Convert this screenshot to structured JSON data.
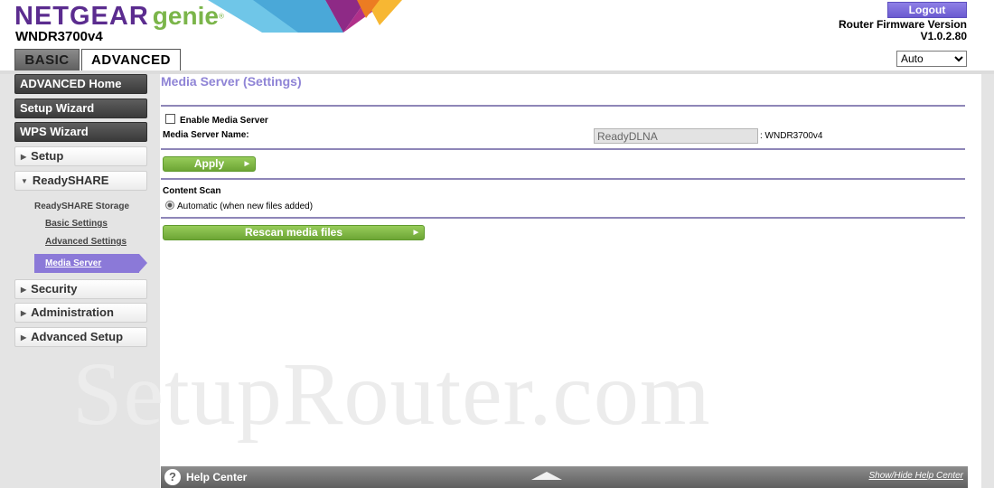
{
  "brand": {
    "name": "NETGEAR",
    "product": "genie",
    "tm": "®",
    "model": "WNDR3700v4"
  },
  "header": {
    "logout_label": "Logout",
    "firmware_label": "Router Firmware Version",
    "firmware_version": "V1.0.2.80",
    "language_selected": "Auto"
  },
  "tabs": [
    {
      "label": "BASIC",
      "active": false
    },
    {
      "label": "ADVANCED",
      "active": true
    }
  ],
  "sidebar": {
    "dark_items": [
      "ADVANCED Home",
      "Setup Wizard",
      "WPS Wizard"
    ],
    "setup": "Setup",
    "readyshare": "ReadySHARE",
    "readyshare_storage": "ReadySHARE Storage",
    "basic_settings": "Basic Settings",
    "advanced_settings": "Advanced Settings",
    "media_server": "Media Server",
    "security": "Security",
    "administration": "Administration",
    "advanced_setup": "Advanced Setup"
  },
  "main": {
    "title": "Media Server (Settings)",
    "enable_label": "Enable Media Server",
    "enable_checked": false,
    "name_label": "Media Server Name:",
    "name_value": "ReadyDLNA",
    "name_suffix": ": WNDR3700v4",
    "apply_label": "Apply",
    "content_scan_label": "Content Scan",
    "automatic_label": "Automatic (when new files added)",
    "rescan_label": "Rescan media files"
  },
  "watermark": "SetupRouter.com",
  "help": {
    "title": "Help Center",
    "toggle_label": "Show/Hide Help Center"
  },
  "colors": {
    "netgear_purple": "#5b2c8f",
    "genie_green": "#7bb54a",
    "accent_purple": "#8b79d8",
    "button_green": "#7ab340"
  },
  "icons": [
    "help-question-icon",
    "triangle-right-icon",
    "triangle-down-icon",
    "expand-up-icon"
  ]
}
